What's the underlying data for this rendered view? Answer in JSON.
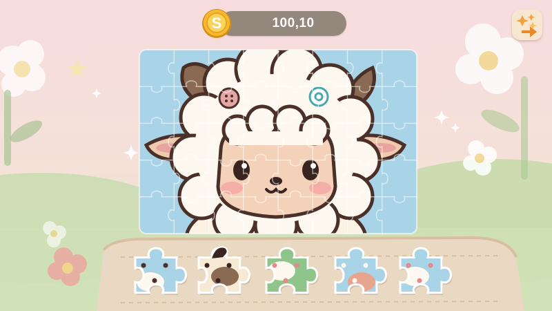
{
  "hud": {
    "coins": "100,10",
    "coin_symbol": "S"
  },
  "icons": {
    "coin": "coin-icon",
    "hint": "sparkle-arrow-icon"
  },
  "board": {
    "image": "cute-sheep-illustration",
    "grid_cols": 8,
    "grid_rows": 5
  },
  "tray": {
    "pieces": [
      {
        "id": "piece-1",
        "pattern": "blue-sky-with-wool"
      },
      {
        "id": "piece-2",
        "pattern": "cream-with-horn-tip",
        "selected": true
      },
      {
        "id": "piece-3",
        "pattern": "green-floral"
      },
      {
        "id": "piece-4",
        "pattern": "blue-with-pink-dome"
      },
      {
        "id": "piece-5",
        "pattern": "blue-and-white-edge"
      }
    ]
  },
  "colors": {
    "background_top": "#f6d9dc",
    "background_bottom": "#c9dfb8",
    "board_sky": "#a9d3e6",
    "wool": "#fdf8f0",
    "face": "#f3d2b9",
    "outline": "#4a3028",
    "coin_gold": "#f2b630",
    "coin_bar": "#8f8477",
    "hint_button": "#f7e7d0"
  }
}
